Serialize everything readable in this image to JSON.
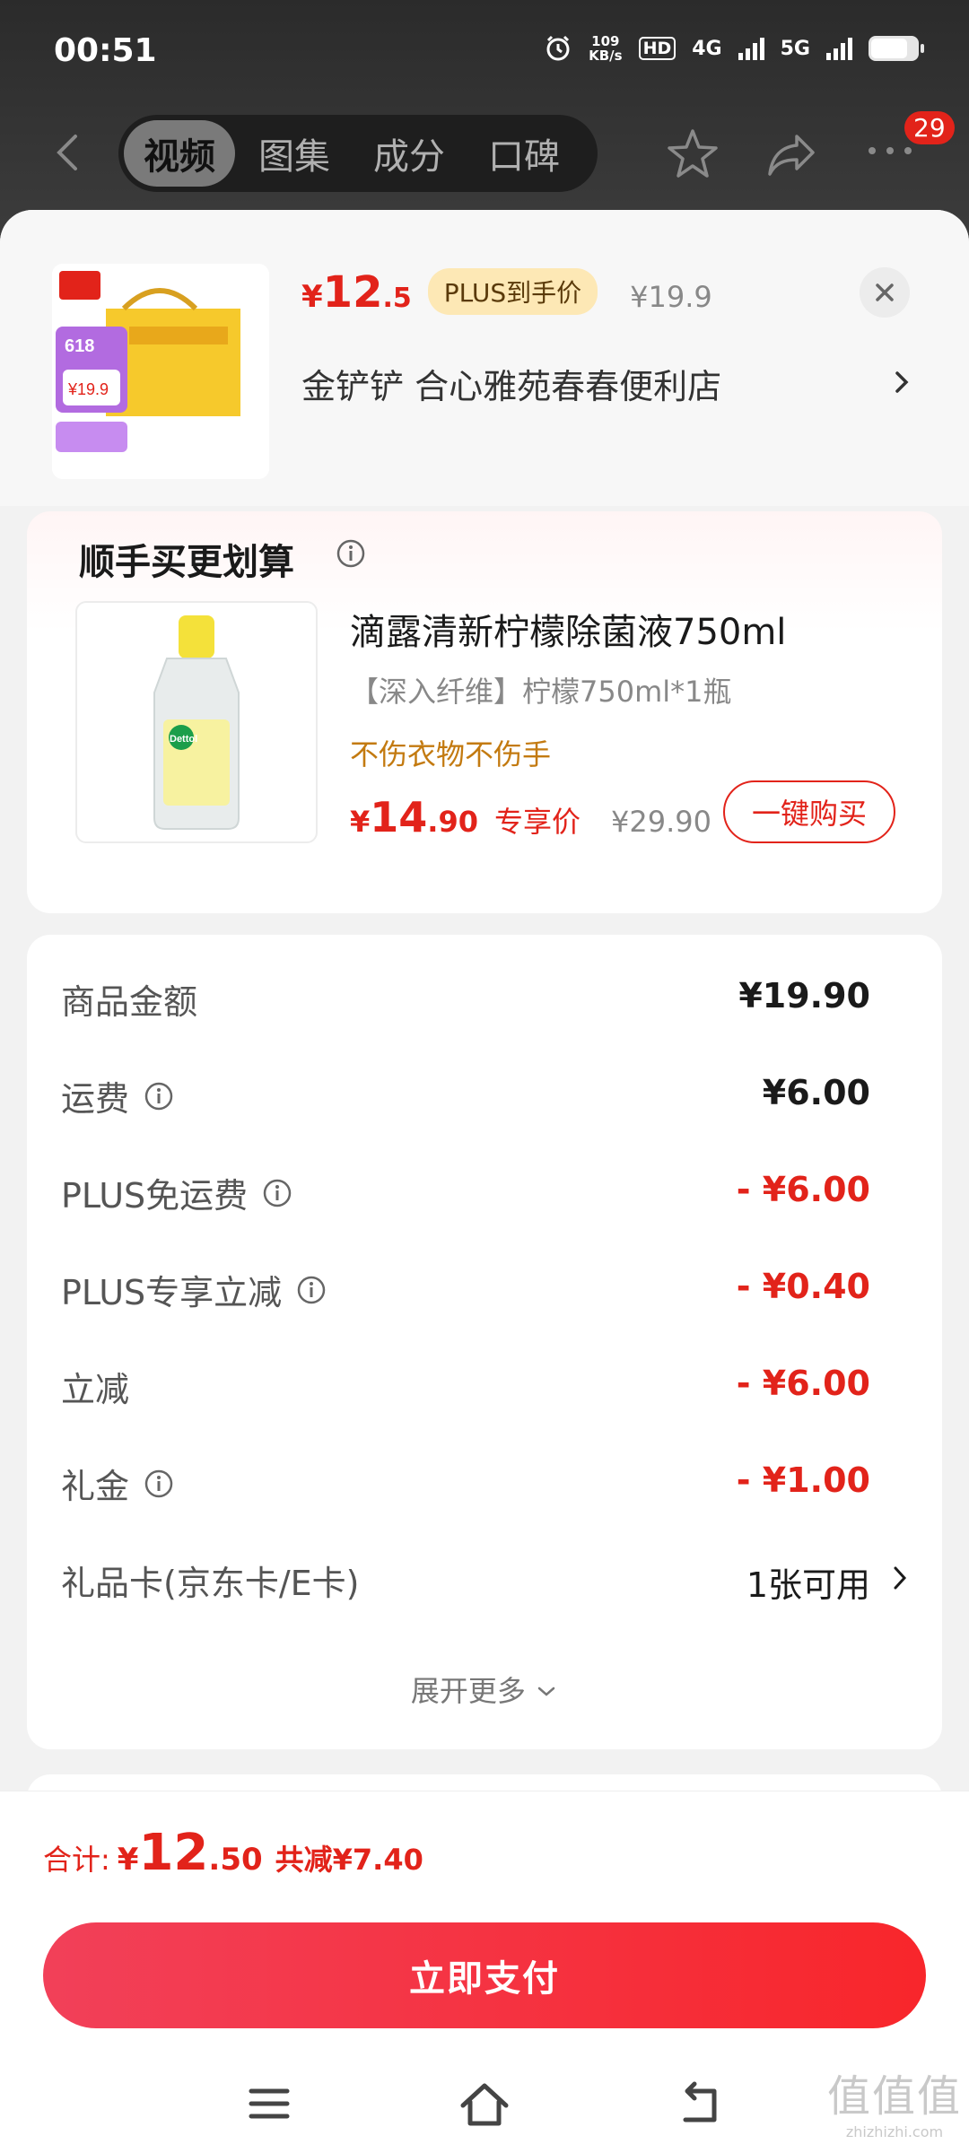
{
  "status_bar": {
    "time": "00:51",
    "net_speed_value": "109",
    "net_speed_unit": "KB/s",
    "hd": "HD",
    "net1": "4G",
    "net2": "5G",
    "battery_level": 0.8
  },
  "header": {
    "tabs": [
      {
        "label": "视频",
        "active": true
      },
      {
        "label": "图集",
        "active": false
      },
      {
        "label": "成分",
        "active": false
      },
      {
        "label": "口碑",
        "active": false
      }
    ],
    "more_badge": "29"
  },
  "product": {
    "thumb_badge": "618",
    "thumb_price": "¥19.9",
    "price_yen": "¥",
    "price_int": "12",
    "price_dec": ".5",
    "plus_tag": "PLUS到手价",
    "orig_price": "¥19.9",
    "store_name": "金铲铲  合心雅苑春春便利店"
  },
  "addon": {
    "title": "顺手买更划算",
    "name": "滴露清新柠檬除菌液750ml",
    "spec": "【深入纤维】柠檬750ml*1瓶",
    "slogan": "不伤衣物不伤手",
    "price_yen": "¥",
    "price_int": "14",
    "price_dec": ".90",
    "exclusive_label": "专享价",
    "orig_price": "¥29.90",
    "buy_label": "一键购买",
    "thumb_brand": "Dettol"
  },
  "cost": {
    "rows": [
      {
        "label": "商品金额",
        "value": "¥19.90"
      },
      {
        "label": "运费",
        "value": "¥6.00"
      },
      {
        "label": "PLUS免运费",
        "value": "- ¥6.00"
      },
      {
        "label": "PLUS专享立减",
        "value": "- ¥0.40"
      },
      {
        "label": "立减",
        "value": "- ¥6.00"
      },
      {
        "label": "礼金",
        "value": "- ¥1.00"
      },
      {
        "label": "礼品卡(京东卡/E卡)",
        "value": "1张可用"
      }
    ],
    "expand_label": "展开更多"
  },
  "footer": {
    "total_label": "合计:",
    "total_yen": "¥",
    "total_int": "12",
    "total_dec": ".50",
    "saved": "共减¥7.40",
    "pay_label": "立即支付"
  },
  "watermark": {
    "big": "值值值",
    "small": "zhizhizhi.com"
  },
  "colors": {
    "accent_red": "#e2231a",
    "plus_gold": "#fde8b5",
    "slogan_orange": "#c37a10"
  }
}
